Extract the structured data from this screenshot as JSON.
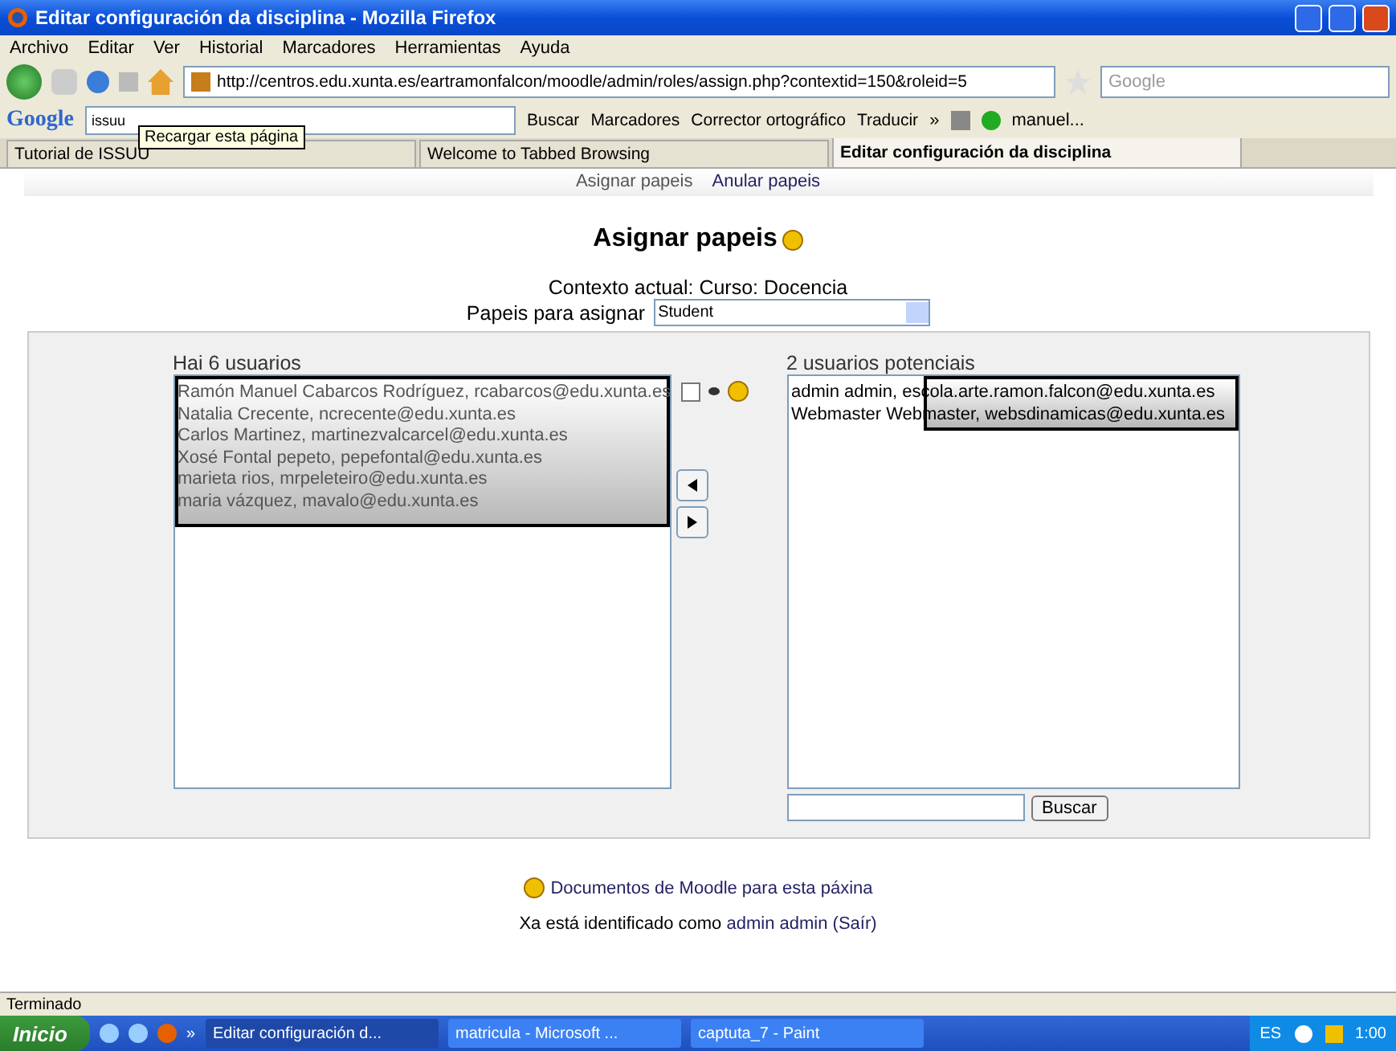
{
  "window": {
    "title": "Editar configuración da disciplina - Mozilla Firefox"
  },
  "menu": [
    "Archivo",
    "Editar",
    "Ver",
    "Historial",
    "Marcadores",
    "Herramientas",
    "Ayuda"
  ],
  "navbar": {
    "url": "http://centros.edu.xunta.es/eartramonfalcon/moodle/admin/roles/assign.php?contextid=150&roleid=5",
    "search_placeholder": "Google"
  },
  "google_toolbar": {
    "logo": "Google",
    "query": "issuu",
    "tooltip": "Recargar esta página",
    "items": [
      {
        "label": "Buscar"
      },
      {
        "label": "Marcadores"
      },
      {
        "label": "Corrector ortográfico"
      },
      {
        "label": "Traducir"
      }
    ],
    "chevron": "»",
    "user": "manuel..."
  },
  "tabs": [
    {
      "label": "Tutorial de ISSUU",
      "selected": false
    },
    {
      "label": "Welcome to Tabbed Browsing",
      "selected": false
    },
    {
      "label": "Editar configuración da disciplina",
      "selected": true
    }
  ],
  "subtabs": [
    {
      "label": "Asignar papeis",
      "selected": true
    },
    {
      "label": "Anular papeis",
      "selected": false
    }
  ],
  "heading": "Asignar papeis",
  "context": "Contexto actual: Curso: Docencia",
  "role_label": "Papeis para asignar",
  "role_value": "Student",
  "existing": {
    "title": "Hai 6 usuarios",
    "users": [
      "Ramón Manuel Cabarcos Rodríguez, rcabarcos@edu.xunta.es",
      "Natalia Crecente, ncrecente@edu.xunta.es",
      "Carlos Martinez, martinezvalcarcel@edu.xunta.es",
      "Xosé Fontal pepeto, pepefontal@edu.xunta.es",
      "marieta rios, mrpeleteiro@edu.xunta.es",
      "maria vázquez, mavalo@edu.xunta.es"
    ]
  },
  "hidden_checkbox": {
    "checked": false
  },
  "potential": {
    "title": "2 usuarios potenciais",
    "users": [
      "admin admin, escola.arte.ramon.falcon@edu.xunta.es",
      "Webmaster Webmaster, websdinamicas@edu.xunta.es"
    ],
    "search_button": "Buscar"
  },
  "docs_link": "Documentos de Moodle para esta páxina",
  "login": {
    "prefix": "Xa está identificado como",
    "user": "admin admin",
    "logout": "(Saír)"
  },
  "status_bar": "Terminado",
  "taskbar": {
    "start": "Inicio",
    "chevron": "»",
    "tasks": [
      {
        "label": "Editar configuración d...",
        "selected": true
      },
      {
        "label": "matricula - Microsoft ...",
        "selected": false
      },
      {
        "label": "captuta_7 - Paint",
        "selected": false
      }
    ],
    "lang": "ES",
    "clock": "1:00"
  }
}
